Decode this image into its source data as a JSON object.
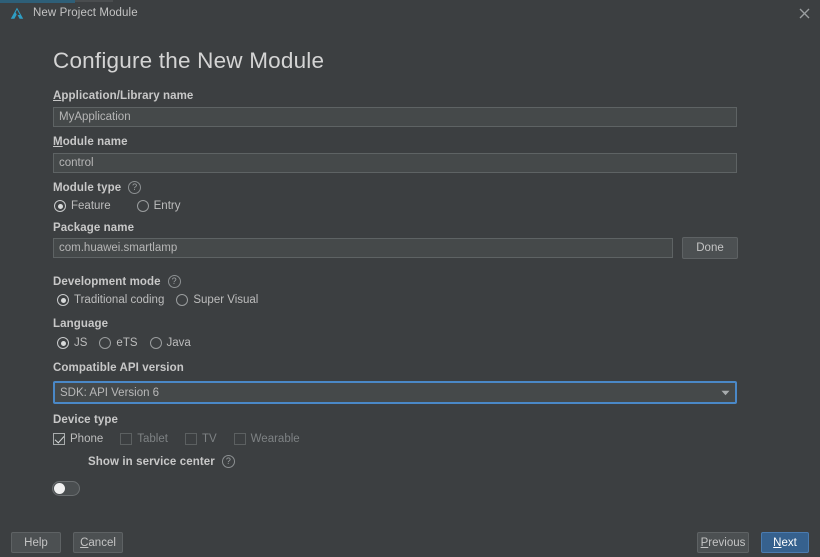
{
  "window": {
    "title": "New Project Module",
    "logo_icon": "huawei-devco-logo-icon",
    "close_icon": "close-icon",
    "accent_color": "#2e5f78"
  },
  "page": {
    "heading": "Configure the New Module"
  },
  "fields": {
    "app_name": {
      "label_mnemonic": "A",
      "label_rest": "pplication/Library name",
      "value": "MyApplication"
    },
    "module_name": {
      "label_mnemonic": "M",
      "label_rest": "odule name",
      "value": "control"
    },
    "module_type": {
      "label": "Module type",
      "help_icon": "question-mark-icon",
      "options": [
        {
          "label": "Feature",
          "selected": true
        },
        {
          "label": "Entry",
          "selected": false
        }
      ]
    },
    "package_name": {
      "label": "Package name",
      "value": "com.huawei.smartlamp",
      "done_button": "Done"
    },
    "development_mode": {
      "label": "Development mode",
      "help_icon": "question-mark-icon",
      "options": [
        {
          "label": "Traditional coding",
          "selected": true
        },
        {
          "label": "Super Visual",
          "selected": false
        }
      ]
    },
    "language": {
      "label": "Language",
      "options": [
        {
          "label": "JS",
          "selected": true
        },
        {
          "label": "eTS",
          "selected": false
        },
        {
          "label": "Java",
          "selected": false
        }
      ]
    },
    "api_version": {
      "label": "Compatible API version",
      "selected": "SDK: API Version 6",
      "options": [
        "SDK: API Version 6"
      ],
      "arrow_icon": "chevron-down-icon",
      "focus_color": "#4a88c7"
    },
    "device_type": {
      "label": "Device type",
      "options": [
        {
          "label": "Phone",
          "checked": true,
          "enabled": true
        },
        {
          "label": "Tablet",
          "checked": false,
          "enabled": false
        },
        {
          "label": "TV",
          "checked": false,
          "enabled": false
        },
        {
          "label": "Wearable",
          "checked": false,
          "enabled": false
        }
      ]
    },
    "service_center": {
      "label": "Show in service center",
      "help_icon": "question-mark-icon",
      "enabled": false
    }
  },
  "footer": {
    "help": "Help",
    "cancel_mnemonic": "C",
    "cancel_rest": "ancel",
    "previous_mnemonic": "P",
    "previous_rest": "revious",
    "next_mnemonic": "N",
    "next_rest": "ext",
    "primary_color": "#36618e"
  }
}
